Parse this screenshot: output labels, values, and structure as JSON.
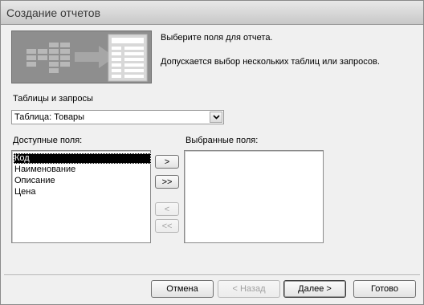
{
  "window": {
    "title": "Создание отчетов"
  },
  "intro": {
    "line1": "Выберите поля для отчета.",
    "line2": "Допускается выбор нескольких таблиц или запросов."
  },
  "source": {
    "label": "Таблицы и запросы",
    "selected": "Таблица: Товары"
  },
  "available": {
    "label": "Доступные поля:",
    "items": [
      "Код",
      "Наименование",
      "Описание",
      "Цена"
    ],
    "selected_index": 0
  },
  "chosen": {
    "label": "Выбранные поля:",
    "items": []
  },
  "move_buttons": {
    "add_one": ">",
    "add_all": ">>",
    "remove_one": "<",
    "remove_all": "<<"
  },
  "footer": {
    "cancel": "Отмена",
    "back": "< Назад",
    "next": "Далее >",
    "finish": "Готово"
  },
  "icons": {
    "wizard_image": "report-wizard-illustration-icon",
    "dropdown": "chevron-down-icon"
  }
}
